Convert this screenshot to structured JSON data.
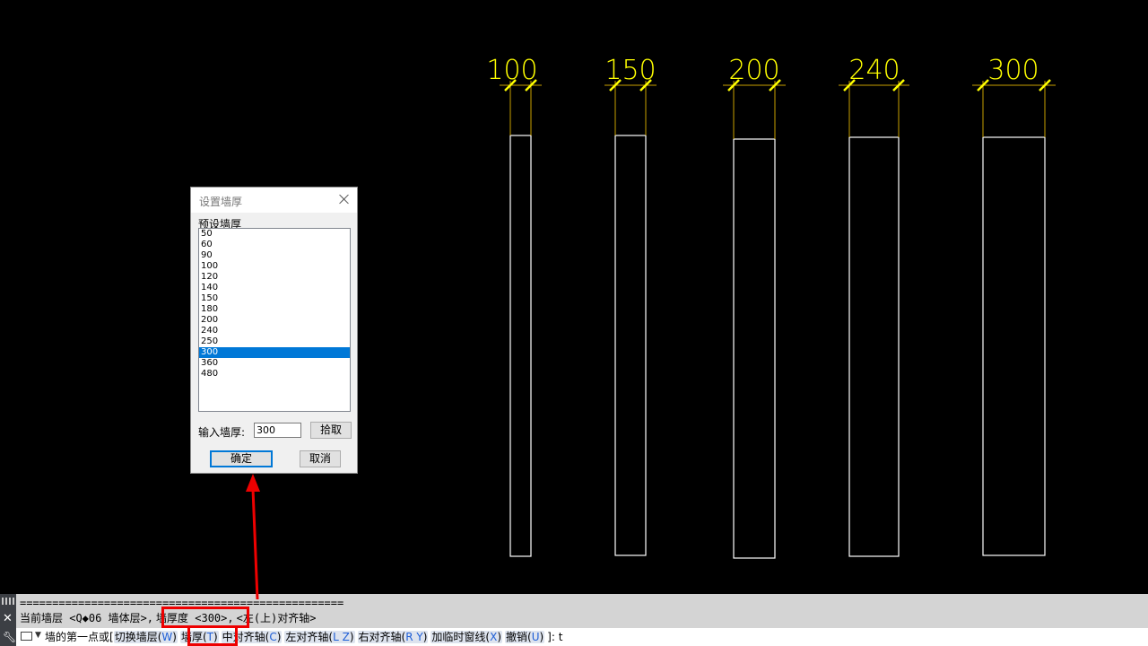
{
  "canvas": {
    "dimension_labels": [
      "100",
      "150",
      "200",
      "240",
      "300"
    ],
    "colors": {
      "background": "#000000",
      "wall_outline": "#ffffff",
      "dimension_text": "#ffff00",
      "extension_line": "#c8a000"
    }
  },
  "dialog": {
    "title": "设置墙厚",
    "close_icon": "close-icon",
    "group_label": "预设墙厚",
    "presets": [
      "50",
      "60",
      "90",
      "100",
      "120",
      "140",
      "150",
      "180",
      "200",
      "240",
      "250",
      "300",
      "360",
      "480"
    ],
    "selected_preset": "300",
    "input_label": "输入墙厚:",
    "input_value": "300",
    "pick_button": "拾取",
    "ok_button": "确定",
    "cancel_button": "取消"
  },
  "command": {
    "history_separator": "==================================================",
    "history_line": {
      "part1": "当前墙层 <Q◆06 墙体层>,",
      "highlight": "墙厚度 <300>,",
      "part2": "<左(上)对齐轴>"
    },
    "prompt": {
      "lead": "墙的第一点或[",
      "options": [
        {
          "text": "切换墙层(",
          "key": "W",
          "close": ")"
        },
        {
          "text": "墙厚(",
          "key": "T",
          "close": ")"
        },
        {
          "text": "中对齐轴(",
          "key": "C",
          "close": ")"
        },
        {
          "text": "左对齐轴(",
          "key": "L Z",
          "close": ")"
        },
        {
          "text": "右对齐轴(",
          "key": "R Y",
          "close": ")"
        },
        {
          "text": "加临时窗线(",
          "key": "X",
          "close": ")"
        },
        {
          "text": "撤销(",
          "key": "U",
          "close": ")"
        }
      ],
      "tail": "]: t"
    },
    "sidebar_icons": [
      "grip-icon",
      "close-icon",
      "wrench-icon"
    ]
  },
  "annotation": {
    "color": "#ee0000"
  }
}
